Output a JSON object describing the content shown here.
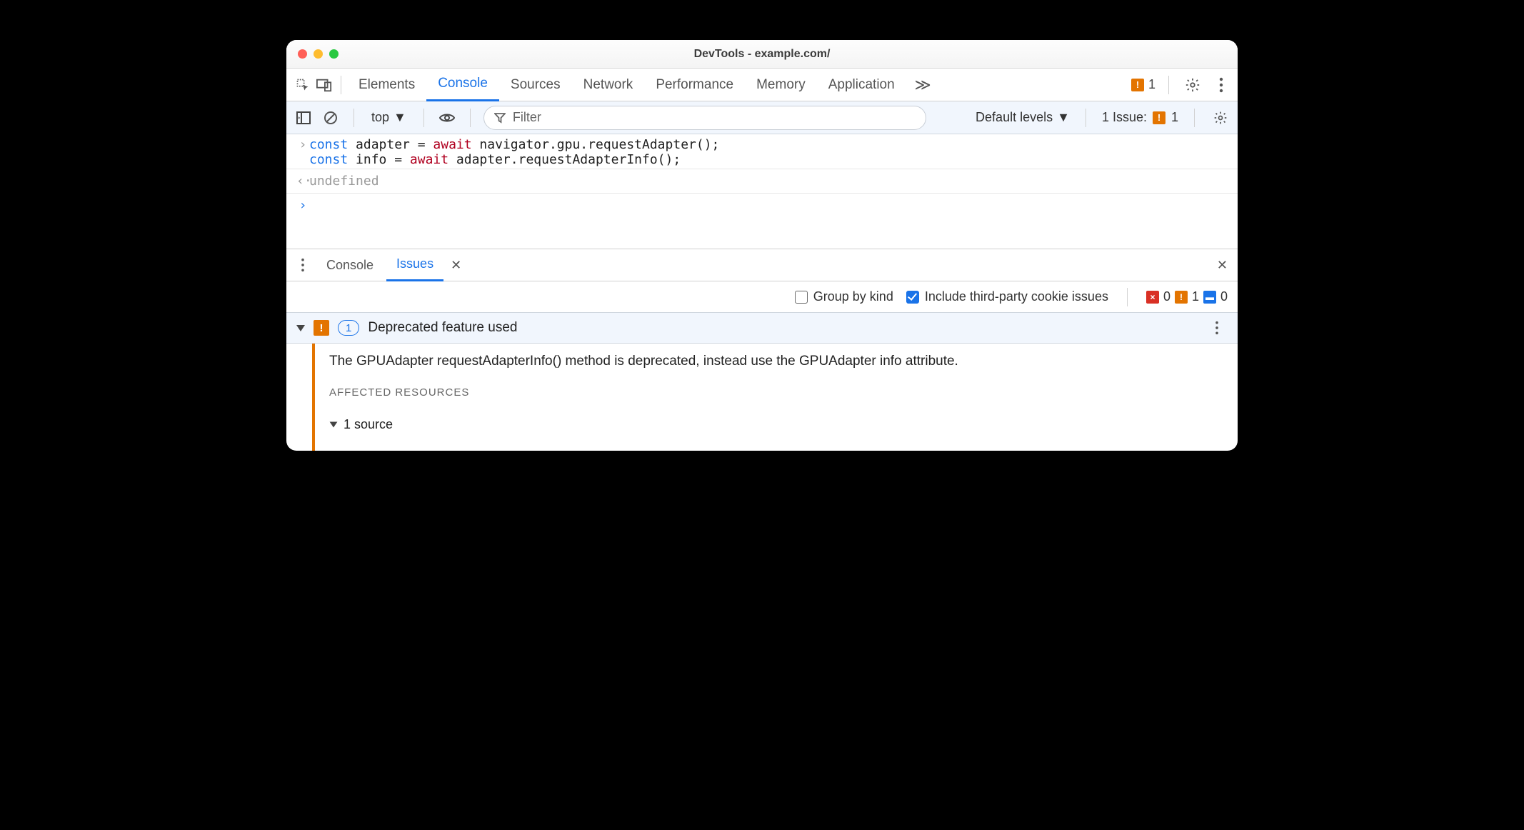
{
  "title": "DevTools - example.com/",
  "toolbar": {
    "tabs": [
      "Elements",
      "Console",
      "Sources",
      "Network",
      "Performance",
      "Memory",
      "Application"
    ],
    "active_tab": "Console",
    "warn_count": "1"
  },
  "subbar": {
    "context": "top",
    "filter_placeholder": "Filter",
    "levels": "Default levels",
    "issues_label": "1 Issue:",
    "issues_count": "1"
  },
  "console": {
    "code_line1_p1": "const",
    "code_line1_p2": " adapter = ",
    "code_line1_p3": "await",
    "code_line1_p4": " navigator.gpu.requestAdapter();",
    "code_line2_p1": "const",
    "code_line2_p2": " info = ",
    "code_line2_p3": "await",
    "code_line2_p4": " adapter.requestAdapterInfo();",
    "result": "undefined"
  },
  "drawer": {
    "tabs": [
      "Console",
      "Issues"
    ],
    "active_tab": "Issues",
    "group_by_kind_label": "Group by kind",
    "group_by_kind_checked": false,
    "third_party_label": "Include third-party cookie issues",
    "third_party_checked": true,
    "counts": {
      "errors": "0",
      "warnings": "1",
      "info": "0"
    }
  },
  "issue": {
    "count_badge": "1",
    "title": "Deprecated feature used",
    "message": "The GPUAdapter requestAdapterInfo() method is deprecated, instead use the GPUAdapter info attribute.",
    "affected_label": "AFFECTED RESOURCES",
    "source_label": "1 source"
  }
}
